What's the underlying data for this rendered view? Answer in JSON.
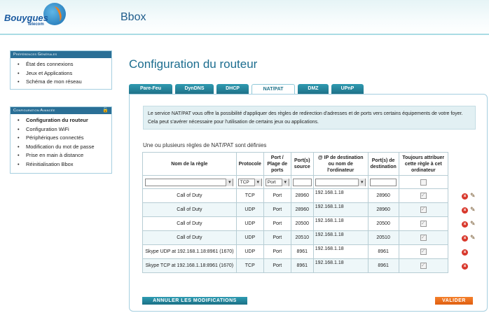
{
  "header": {
    "brand": "Bouygues",
    "brand_sub": "telecom",
    "app_title": "Bbox"
  },
  "sidebar": {
    "general": {
      "title": "Préférences Générales",
      "items": [
        {
          "label": "État des connexions"
        },
        {
          "label": "Jeux et Applications"
        },
        {
          "label": "Schéma de mon réseau"
        }
      ]
    },
    "advanced": {
      "title": "Configuration Avancée",
      "items": [
        {
          "label": "Configuration du routeur",
          "active": true
        },
        {
          "label": "Configuration WiFi"
        },
        {
          "label": "Périphériques connectés"
        },
        {
          "label": "Modification du mot de passe"
        },
        {
          "label": "Prise en main à distance"
        },
        {
          "label": "Réinitialisation Bbox"
        }
      ]
    }
  },
  "main": {
    "title": "Configuration du routeur",
    "tabs": [
      {
        "label": "Pare-Feu"
      },
      {
        "label": "DynDNS"
      },
      {
        "label": "DHCP"
      },
      {
        "label": "NAT/PAT",
        "active": true
      },
      {
        "label": "DMZ"
      },
      {
        "label": "UPnP"
      }
    ],
    "info": "Le service NAT/PAT vous offre la possibilité d'appliquer des règles de redirection d'adresses et de ports vers certains équipements de votre foyer. Cela peut s'avérer nécessaire pour l'utilisation de certains jeux ou applications.",
    "rules_title": "Une ou plusieurs règles de NAT/PAT sont définies",
    "table": {
      "headers": [
        "Nom de la règle",
        "Protocole",
        "Port / Plage de ports",
        "Port(s) source",
        "@ IP de destination ou nom de l'ordinateur",
        "Port(s) de destination",
        "Toujours attribuer cette règle à cet ordinateur"
      ],
      "filter": {
        "protocol": "TCP",
        "port_mode": "Port"
      },
      "rows": [
        {
          "name": "Call of Duty",
          "protocol": "TCP",
          "mode": "Port",
          "source": "28960",
          "ip": "192.168.1.18",
          "dest": "28960",
          "editable": true
        },
        {
          "name": "Call of Duty",
          "protocol": "UDP",
          "mode": "Port",
          "source": "28960",
          "ip": "192.168.1.18",
          "dest": "28960",
          "editable": true
        },
        {
          "name": "Call of Duty",
          "protocol": "UDP",
          "mode": "Port",
          "source": "20500",
          "ip": "192.168.1.18",
          "dest": "20500",
          "editable": true
        },
        {
          "name": "Call of Duty",
          "protocol": "UDP",
          "mode": "Port",
          "source": "20510",
          "ip": "192.168.1.18",
          "dest": "20510",
          "editable": true
        },
        {
          "name": "Skype UDP at 192.168.1.18:8961 (1670)",
          "protocol": "UDP",
          "mode": "Port",
          "source": "8961",
          "ip": "192.168.1.18",
          "dest": "8961",
          "editable": false
        },
        {
          "name": "Skype TCP at 192.168.1.18:8961 (1670)",
          "protocol": "TCP",
          "mode": "Port",
          "source": "8961",
          "ip": "192.168.1.18",
          "dest": "8961",
          "editable": false
        }
      ]
    },
    "cancel_label": "ANNULER LES MODIFICATIONS",
    "validate_label": "VALIDER"
  }
}
